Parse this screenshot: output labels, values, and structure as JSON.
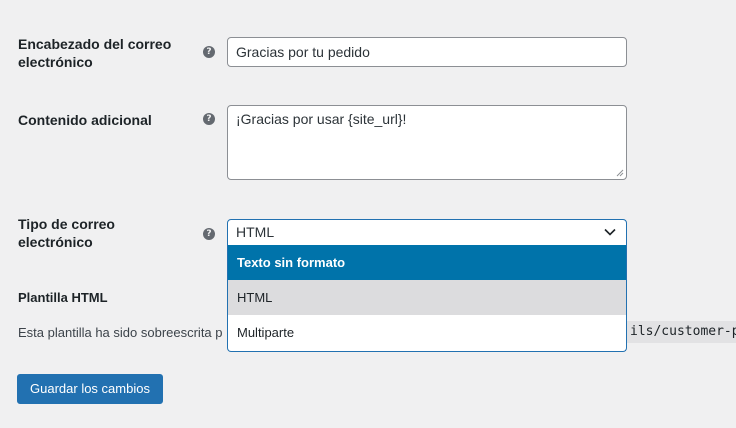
{
  "fields": {
    "email_heading": {
      "label": "Encabezado del correo electrónico",
      "value": "Gracias por tu pedido",
      "help_icon": "question-circle-icon"
    },
    "additional_content": {
      "label": "Contenido adicional",
      "value": "¡Gracias por usar {site_url}!",
      "help_icon": "question-circle-icon"
    },
    "email_type": {
      "label": "Tipo de correo electrónico",
      "selected": "HTML",
      "help_icon": "question-circle-icon",
      "dropdown_open": true,
      "options": [
        {
          "label": "Texto sin formato",
          "state": "highlighted"
        },
        {
          "label": "HTML",
          "state": "selected"
        },
        {
          "label": "Multiparte",
          "state": "normal"
        }
      ]
    }
  },
  "html_template": {
    "label": "Plantilla HTML",
    "description_visible": "Esta plantilla ha sido sobreescrita p",
    "path_fragment": "ils/customer-p"
  },
  "buttons": {
    "save": "Guardar los cambios"
  },
  "colors": {
    "page_bg": "#f0f0f1",
    "accent": "#2271b1",
    "highlight_option": "#0073aa",
    "selected_option": "#dcdcde"
  }
}
